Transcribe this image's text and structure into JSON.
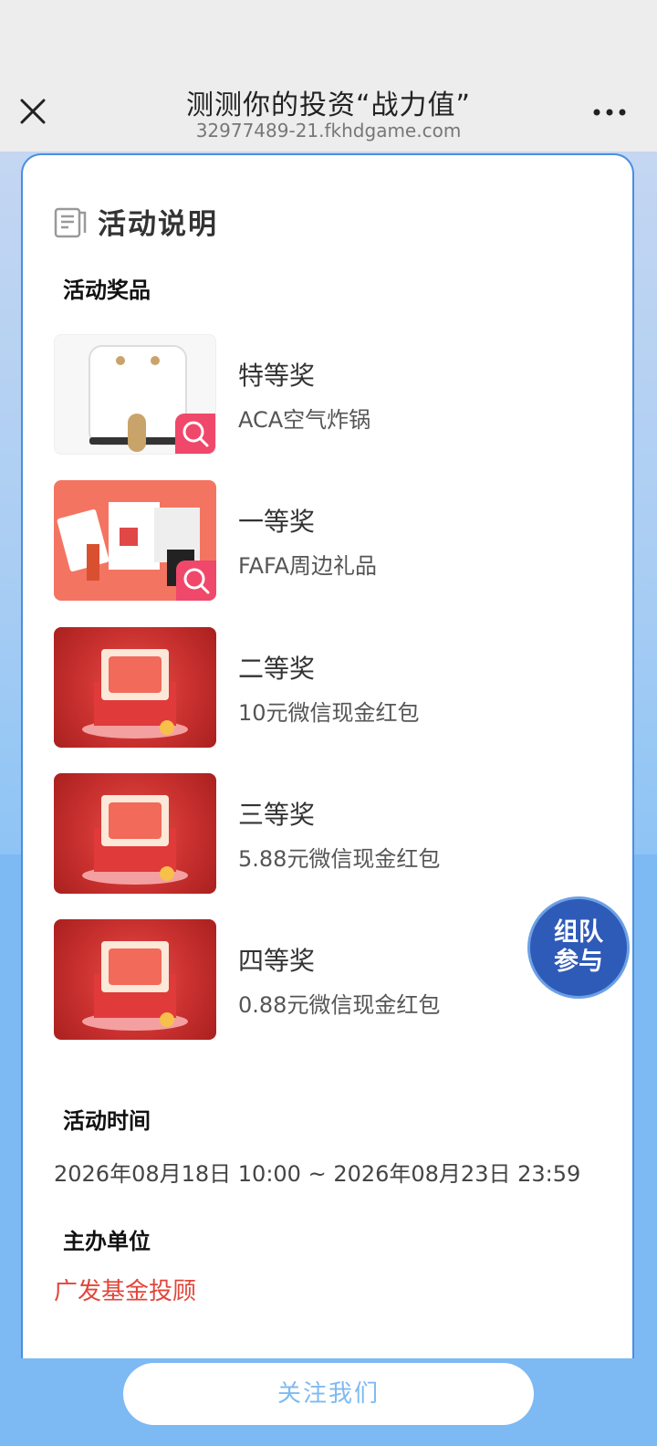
{
  "header": {
    "title": "测测你的投资“战力值”",
    "subtitle": "32977489-21.fkhdgame.com"
  },
  "panel": {
    "title": "活动说明",
    "prizes_section": "活动奖品",
    "prizes": [
      {
        "rank": "特等奖",
        "name": "ACA空气炸锅",
        "image": "air-fryer",
        "zoom": true
      },
      {
        "rank": "一等奖",
        "name": "FAFA周边礼品",
        "image": "fafa-gifts",
        "zoom": true
      },
      {
        "rank": "二等奖",
        "name": "10元微信现金红包",
        "image": "red-envelope",
        "zoom": false
      },
      {
        "rank": "三等奖",
        "name": "5.88元微信现金红包",
        "image": "red-envelope",
        "zoom": false
      },
      {
        "rank": "四等奖",
        "name": "0.88元微信现金红包",
        "image": "red-envelope",
        "zoom": false
      }
    ],
    "time_section": "活动时间",
    "time_value": "2026年08月18日 10:00 ~ 2026年08月23日 23:59",
    "org_section": "主办单位",
    "org_value": "广发基金投顾"
  },
  "team_button": {
    "line1": "组队",
    "line2": "参与"
  },
  "follow_button": "关注我们",
  "colors": {
    "accent_blue": "#7db9f3",
    "zoom_pink": "#f0486a",
    "org_red": "#e2453b",
    "team_blue": "#2f5bb8"
  }
}
